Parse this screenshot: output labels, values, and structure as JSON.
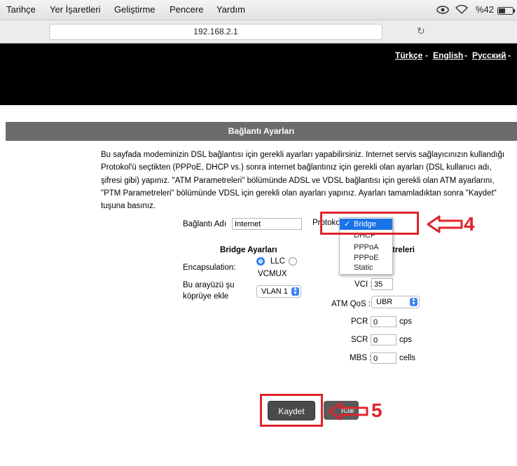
{
  "menubar": {
    "items": [
      "Tarihçe",
      "Yer İşaretleri",
      "Geliştirme",
      "Pencere",
      "Yardım"
    ],
    "battery": "%42"
  },
  "browser": {
    "url": "192.168.2.1"
  },
  "languages": [
    "Türkçe",
    "English",
    "Русский"
  ],
  "page": {
    "title": "Bağlantı Ayarları",
    "description": "Bu sayfada modeminizin DSL bağlantısı için gerekli ayarları yapabilirsiniz. Internet servis sağlayıcınızın kullandığı Protokol'ü seçtikten (PPPoE, DHCP vs.) sonra internet bağlantınız için gerekli olan ayarları (DSL kullanıcı adı, şifresi gibi) yapınız. \"ATM Parametreleri\" bölümünde ADSL ve VDSL bağlantısı için gerekli olan ATM ayarlarını, \"PTM Parametreleri\" bölümünde VDSL için gerekli olan ayarları yapınız. Ayarları tamamladıktan sonra \"Kaydet\" tuşuna basınız."
  },
  "form": {
    "connection_name_label": "Bağlantı Adı",
    "connection_name_value": "Internet",
    "protocol_label": "Protoko",
    "protocol_options": [
      "Bridge",
      "DHCP",
      "PPPoA",
      "PPPoE",
      "Static"
    ],
    "protocol_selected": "Bridge",
    "protocol_check": "✓",
    "bridge_section_title": "Bridge Ayarları",
    "encapsulation_label": "Encapsulation:",
    "encap_llc": "LLC",
    "encap_vcmux": "VCMUX",
    "bridge_iface_label_line1": "Bu arayüzü şu",
    "bridge_iface_label_line2": "köprüye ekle",
    "vlan_value": "VLAN 1",
    "atm_section_title_partial": "treleri",
    "vci_label": "VCI :",
    "vci_value": "35",
    "atm_qos_label": "ATM QoS :",
    "atm_qos_value": "UBR",
    "pcr_label": "PCR :",
    "pcr_value": "0",
    "pcr_unit": "cps",
    "scr_label": "SCR :",
    "scr_value": "0",
    "scr_unit": "cps",
    "mbs_label": "MBS :",
    "mbs_value": "0",
    "mbs_unit": "cells"
  },
  "buttons": {
    "save": "Kaydet",
    "cancel_partial": "ıcal"
  },
  "annotations": {
    "step4": "4",
    "step5": "5",
    "color": "#e0242c"
  }
}
